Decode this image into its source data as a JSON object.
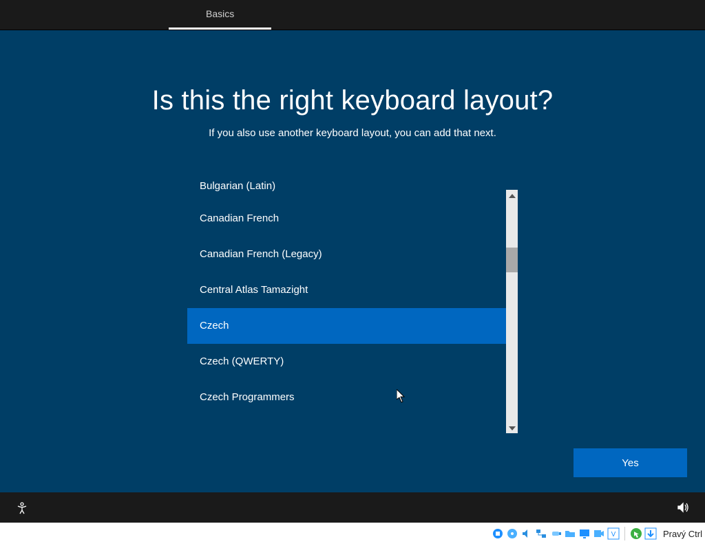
{
  "tabbar": {
    "active_tab": "Basics"
  },
  "heading": {
    "title": "Is this the right keyboard layout?",
    "subtitle": "If you also use another keyboard layout, you can add that next."
  },
  "layouts": {
    "items": [
      "Bulgarian (Latin)",
      "Canadian French",
      "Canadian French (Legacy)",
      "Central Atlas Tamazight",
      "Czech",
      "Czech (QWERTY)",
      "Czech Programmers"
    ],
    "selected_index": 4
  },
  "buttons": {
    "yes": "Yes"
  },
  "host": {
    "key_label": "Pravý Ctrl"
  }
}
